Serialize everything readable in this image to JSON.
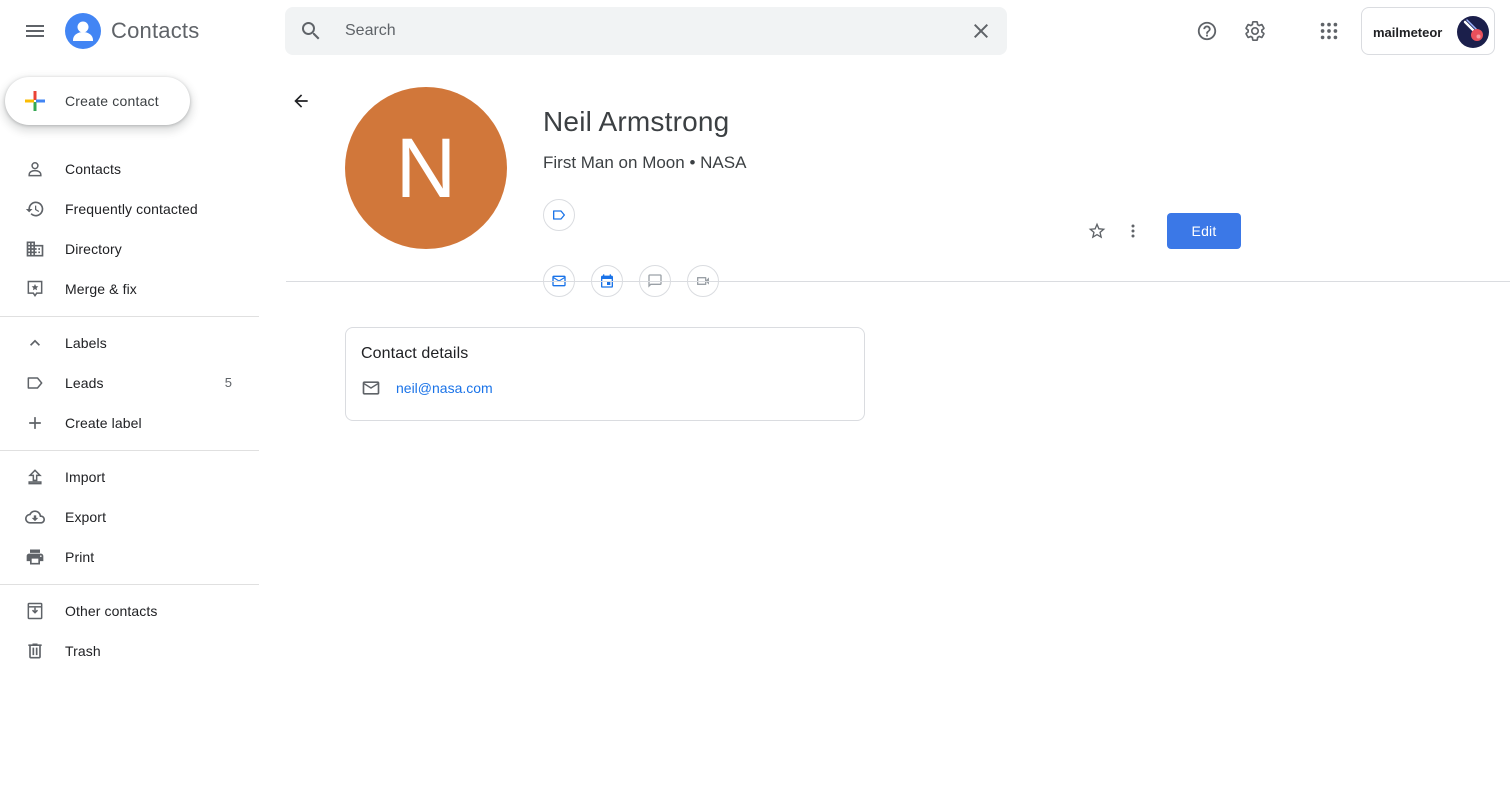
{
  "header": {
    "app_title": "Contacts",
    "search_placeholder": "Search",
    "account_name": "mailmeteor"
  },
  "sidebar": {
    "create_label": "Create contact",
    "items": [
      {
        "label": "Contacts",
        "icon": "person-icon"
      },
      {
        "label": "Frequently contacted",
        "icon": "history-icon"
      },
      {
        "label": "Directory",
        "icon": "building-icon"
      },
      {
        "label": "Merge & fix",
        "icon": "merge-fix-icon"
      }
    ],
    "labels_header": "Labels",
    "labels": [
      {
        "label": "Leads",
        "count": "5",
        "icon": "label-icon"
      }
    ],
    "create_label_label": "Create label",
    "actions": [
      {
        "label": "Import",
        "icon": "upload-icon"
      },
      {
        "label": "Export",
        "icon": "cloud-download-icon"
      },
      {
        "label": "Print",
        "icon": "printer-icon"
      }
    ],
    "other_contacts_label": "Other contacts",
    "trash_label": "Trash"
  },
  "contact": {
    "initial": "N",
    "avatar_color": "#d1773a",
    "name": "Neil Armstrong",
    "subtitle": "First Man on Moon • NASA",
    "edit_label": "Edit",
    "details_title": "Contact details",
    "email": "neil@nasa.com"
  },
  "colors": {
    "accent": "#3b78e7",
    "link": "#1a73e8",
    "logo_blue": "#4285f4"
  }
}
